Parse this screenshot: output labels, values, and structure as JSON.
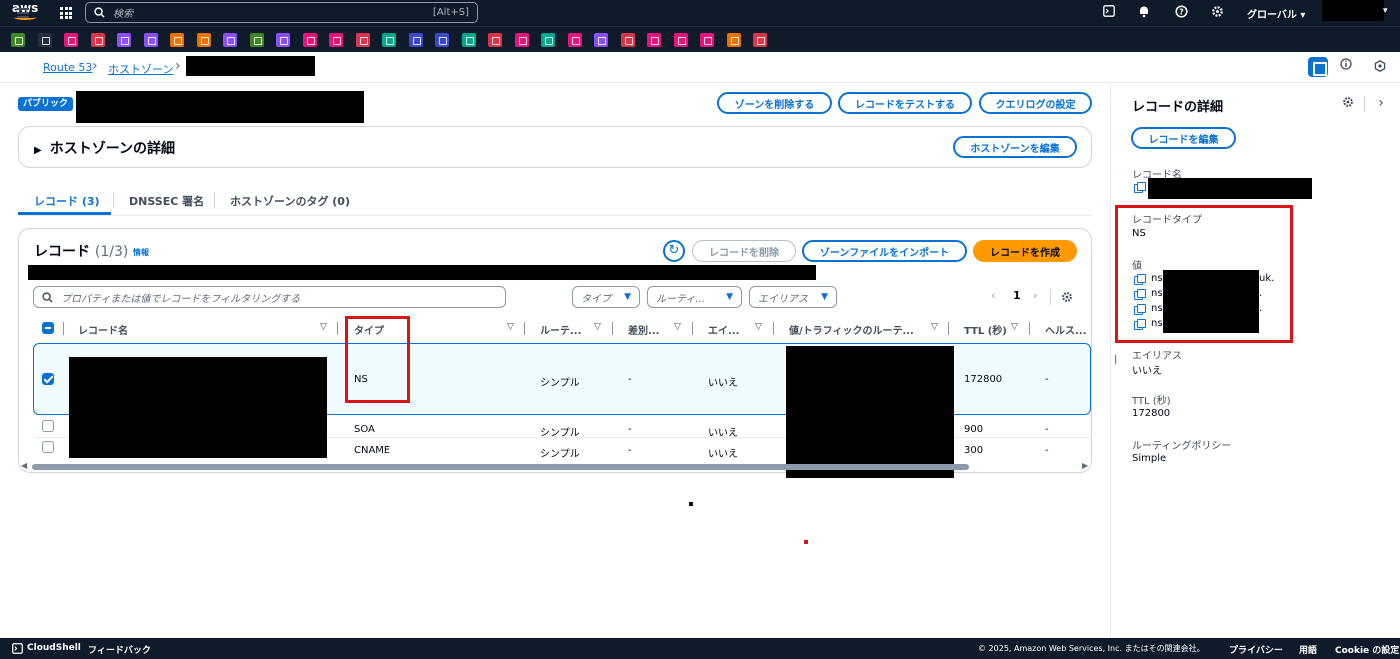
{
  "topnav": {
    "logo": "aws",
    "search_placeholder": "検索",
    "search_shortcut": "[Alt+S]",
    "region": "グローバル",
    "icons": [
      "cloudshell-icon",
      "bell-icon",
      "help-icon",
      "gear-icon"
    ]
  },
  "favorites": {
    "colors": [
      "#3f8624",
      "#232f3e",
      "#e7157b",
      "#dd344c",
      "#8c4fff",
      "#8c4fff",
      "#ed7100",
      "#ed7100",
      "#8c4fff",
      "#3f8624",
      "#8c4fff",
      "#e7157b",
      "#e7157b",
      "#dd344c",
      "#01a88d",
      "#3b48cc",
      "#3b48cc",
      "#01a88d",
      "#dd344c",
      "#e7157b",
      "#01a88d",
      "#e7157b",
      "#8c4fff",
      "#dd344c",
      "#e7157b",
      "#e7157b",
      "#e7157b",
      "#ed7100",
      "#dd344c"
    ]
  },
  "breadcrumb": {
    "items": [
      "Route 53",
      "ホストゾーン"
    ]
  },
  "zone": {
    "badge": "パブリック",
    "actions": {
      "delete_zone": "ゾーンを削除する",
      "test_record": "レコードをテストする",
      "query_log": "クエリログの設定"
    },
    "details_title": "ホストゾーンの詳細",
    "edit_zone": "ホストゾーンを編集"
  },
  "tabs": [
    {
      "label": "レコード (3)"
    },
    {
      "label": "DNSSEC 署名"
    },
    {
      "label": "ホストゾーンのタグ (0)"
    }
  ],
  "records": {
    "title": "レコード",
    "count": "(1/3)",
    "info": "情報",
    "delete_label": "レコードを削除",
    "import_label": "ゾーンファイルをインポート",
    "create_label": "レコードを作成",
    "filter_placeholder": "プロパティまたは値でレコードをフィルタリングする",
    "type_filter": "タイプ",
    "routing_filter": "ルーティ...",
    "alias_filter": "エイリアス",
    "page": "1",
    "columns": [
      "レコード名",
      "タイプ",
      "ルーテ...",
      "差別...",
      "エイ...",
      "値/トラフィックのルーテ...",
      "TTL (秒)",
      "ヘルス..."
    ],
    "rows": [
      {
        "type": "NS",
        "routing": "シンプル",
        "diff": "-",
        "alias": "いいえ",
        "ttl": "172800",
        "health": "-"
      },
      {
        "type": "SOA",
        "routing": "シンプル",
        "diff": "-",
        "alias": "いいえ",
        "ttl": "900",
        "health": "-"
      },
      {
        "type": "CNAME",
        "routing": "シンプル",
        "diff": "-",
        "alias": "いいえ",
        "ttl": "300",
        "health": "-"
      }
    ]
  },
  "details_panel": {
    "title": "レコードの詳細",
    "edit_label": "レコードを編集",
    "name_label": "レコード名",
    "type_label": "レコードタイプ",
    "type_value": "NS",
    "value_label": "値",
    "values": [
      "ns-",
      "ns-",
      "ns-",
      "ns"
    ],
    "value_suffixes": [
      "uk.",
      ".",
      ".",
      ""
    ],
    "alias_label": "エイリアス",
    "alias_value": "いいえ",
    "ttl_label": "TTL (秒)",
    "ttl_value": "172800",
    "routing_label": "ルーティングポリシー",
    "routing_value": "Simple"
  },
  "footer": {
    "cloudshell": "CloudShell",
    "feedback": "フィードバック",
    "copyright": "© 2025, Amazon Web Services, Inc. またはその関連会社。",
    "privacy": "プライバシー",
    "terms": "用語",
    "cookie": "Cookie の設定"
  },
  "colors": {
    "accent": "#0972d3",
    "primary": "#ff9900",
    "highlight": "#d91515"
  }
}
